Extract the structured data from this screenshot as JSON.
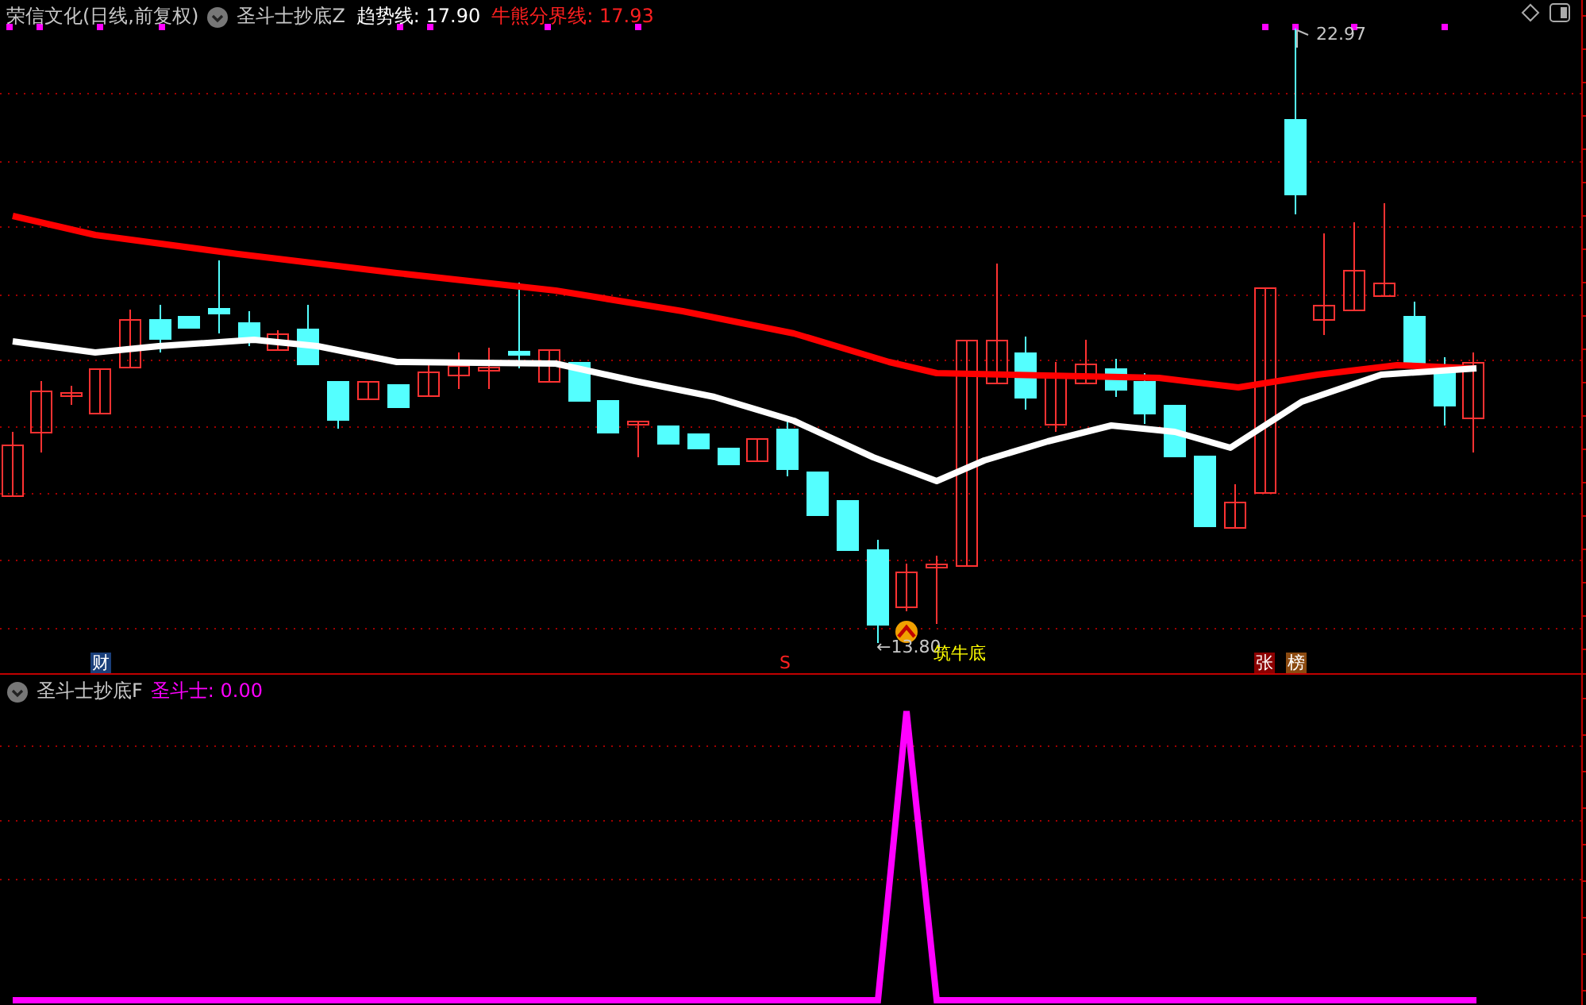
{
  "main_pane": {
    "stock_title": "荣信文化(日线,前复权)",
    "indicator": "圣斗士抄底Z",
    "readouts": [
      {
        "label": "趋势线:",
        "value": "17.90",
        "color": "#ffffff"
      },
      {
        "label": "牛熊分界线:",
        "value": "17.93",
        "color": "#ff2020"
      }
    ],
    "high_label": "22.97",
    "low_label": "←13.80",
    "low_tag": "筑牛底",
    "badges": [
      {
        "kind": "box",
        "text": "财",
        "color": "#1a3f7a"
      },
      {
        "kind": "text",
        "text": "S",
        "color": "#ff2020"
      },
      {
        "kind": "box",
        "text": "张",
        "color": "#8b0000"
      },
      {
        "kind": "box",
        "text": "榜",
        "color": "#8b4a10"
      }
    ]
  },
  "sub_pane": {
    "indicator": "圣斗士抄底F",
    "readout": {
      "label": "圣斗士:",
      "value": "0.00"
    }
  }
}
